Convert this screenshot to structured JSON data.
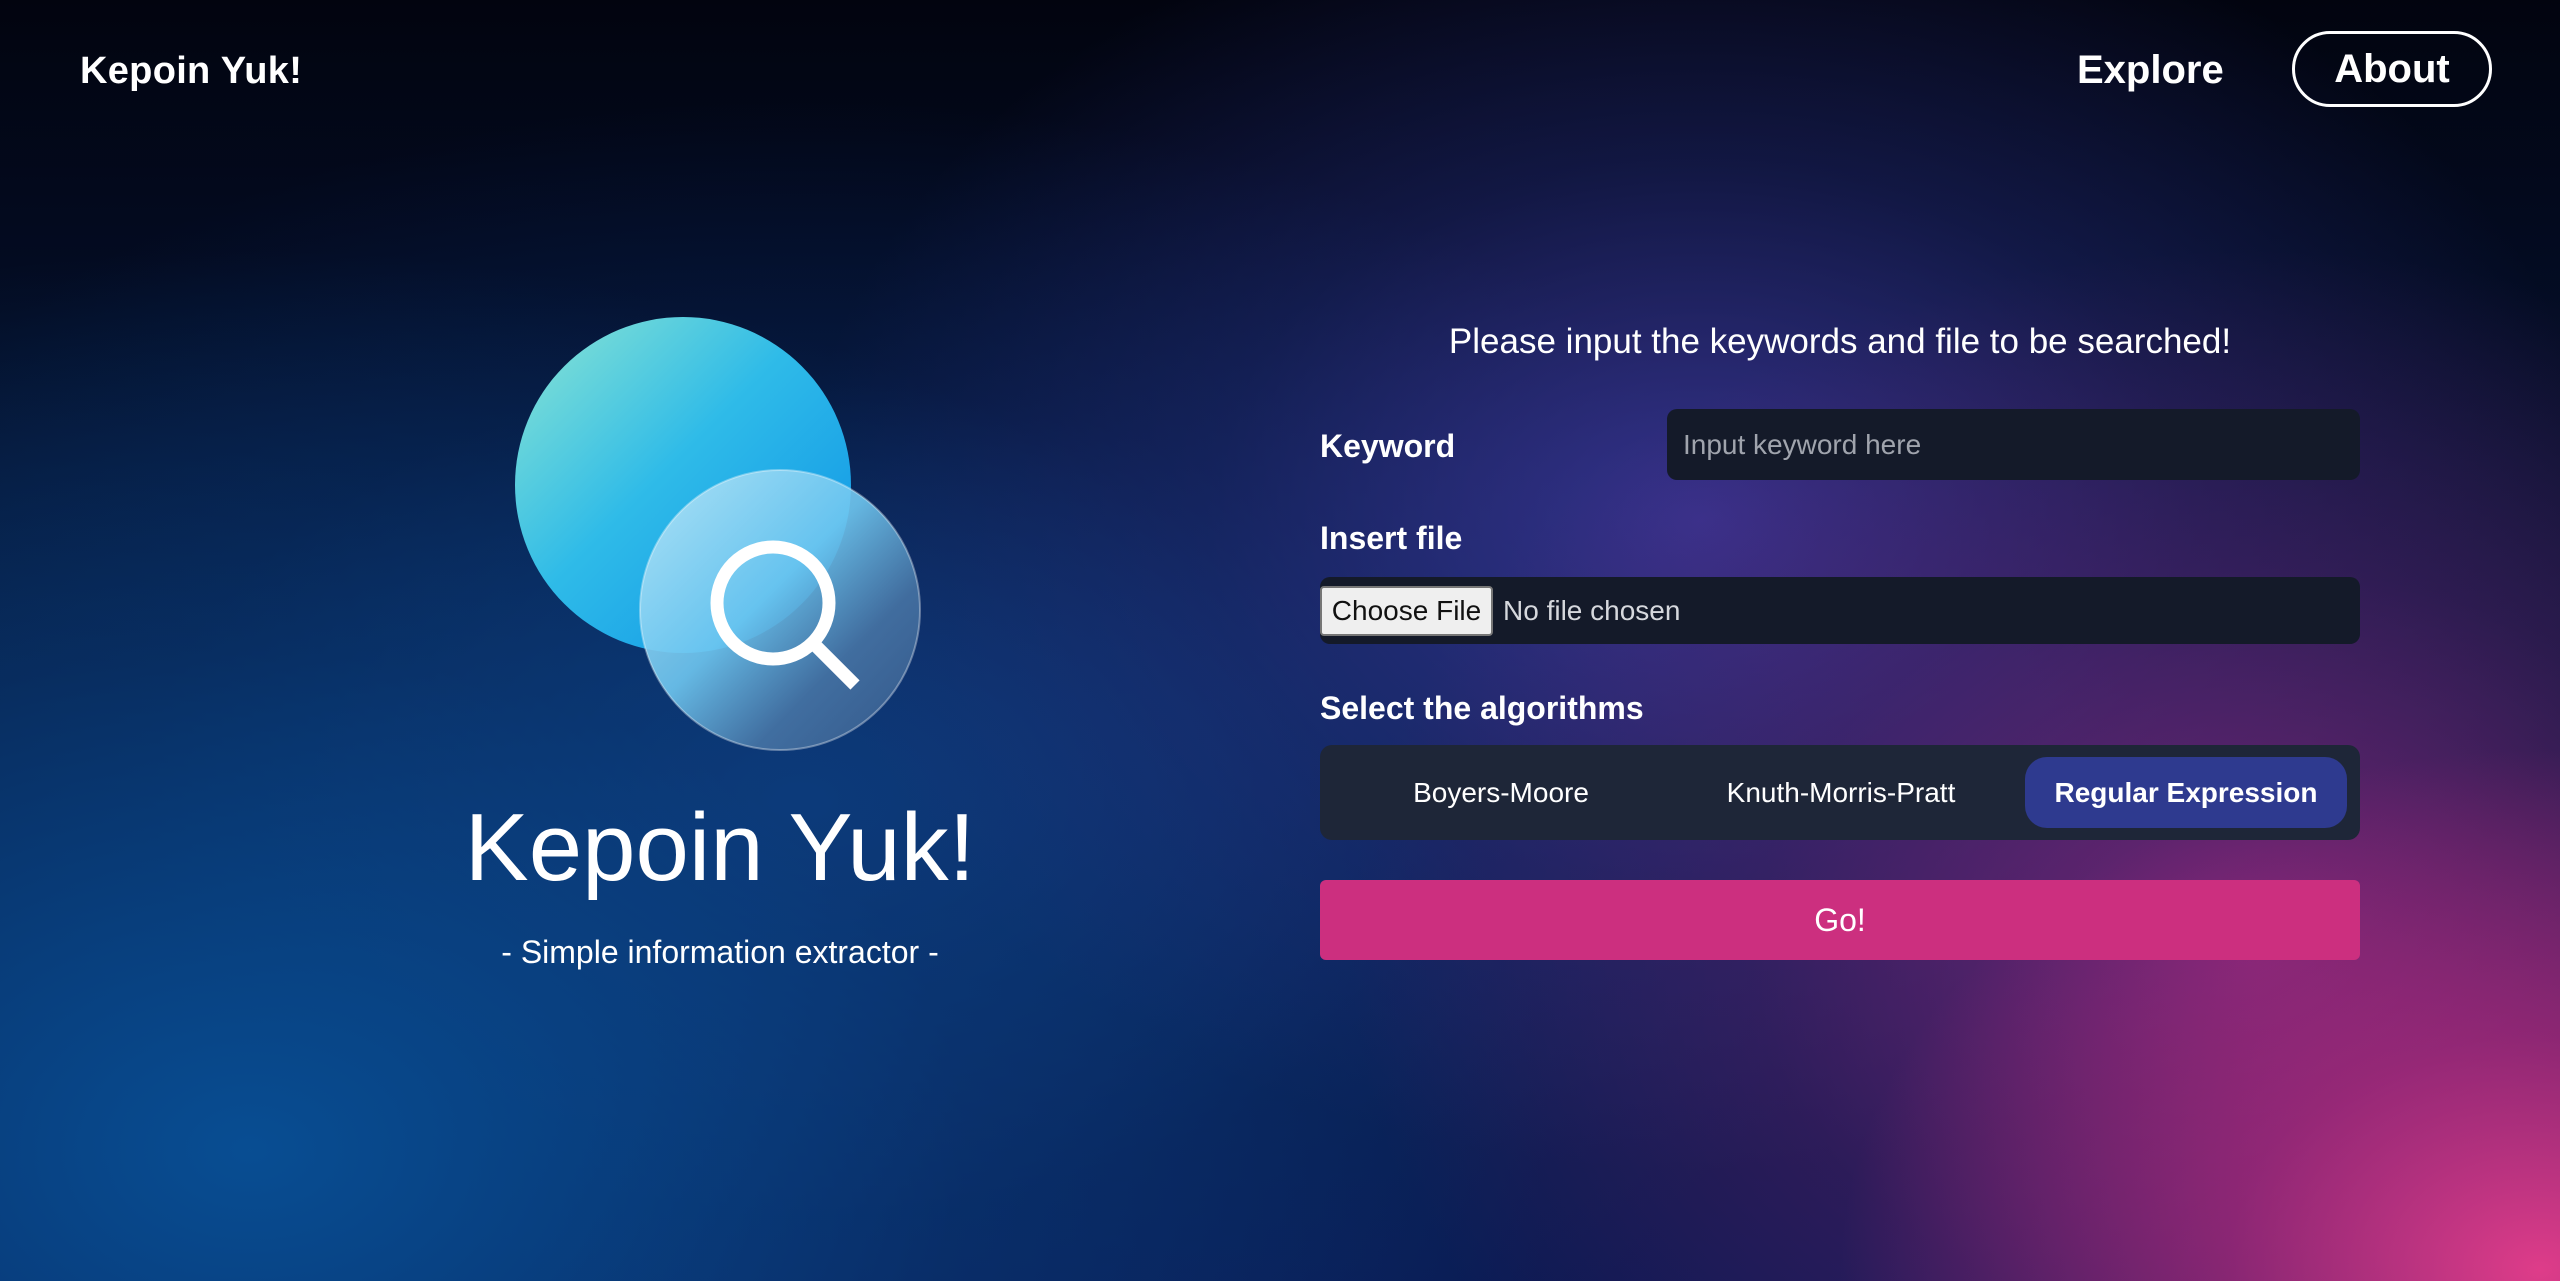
{
  "nav": {
    "brand": "Kepoin Yuk!",
    "links": {
      "explore": "Explore",
      "about": "About"
    }
  },
  "hero": {
    "title": "Kepoin Yuk!",
    "subtitle": "- Simple information extractor -"
  },
  "form": {
    "heading": "Please input the keywords and file to be searched!",
    "keyword": {
      "label": "Keyword",
      "placeholder": "Input keyword here",
      "value": ""
    },
    "file": {
      "label": "Insert file",
      "button_label": "Choose File",
      "status": "No file chosen"
    },
    "algorithms": {
      "label": "Select the algorithms",
      "options": [
        "Boyers-Moore",
        "Knuth-Morris-Pratt",
        "Regular Expression"
      ],
      "selected": "Regular Expression"
    },
    "submit_label": "Go!"
  },
  "colors": {
    "accent_pink": "#cc2f7f",
    "selected_option": "#2e3a8f",
    "input_bg": "#141a29"
  },
  "icons": {
    "logo": "magnifier-bubble-icon"
  }
}
